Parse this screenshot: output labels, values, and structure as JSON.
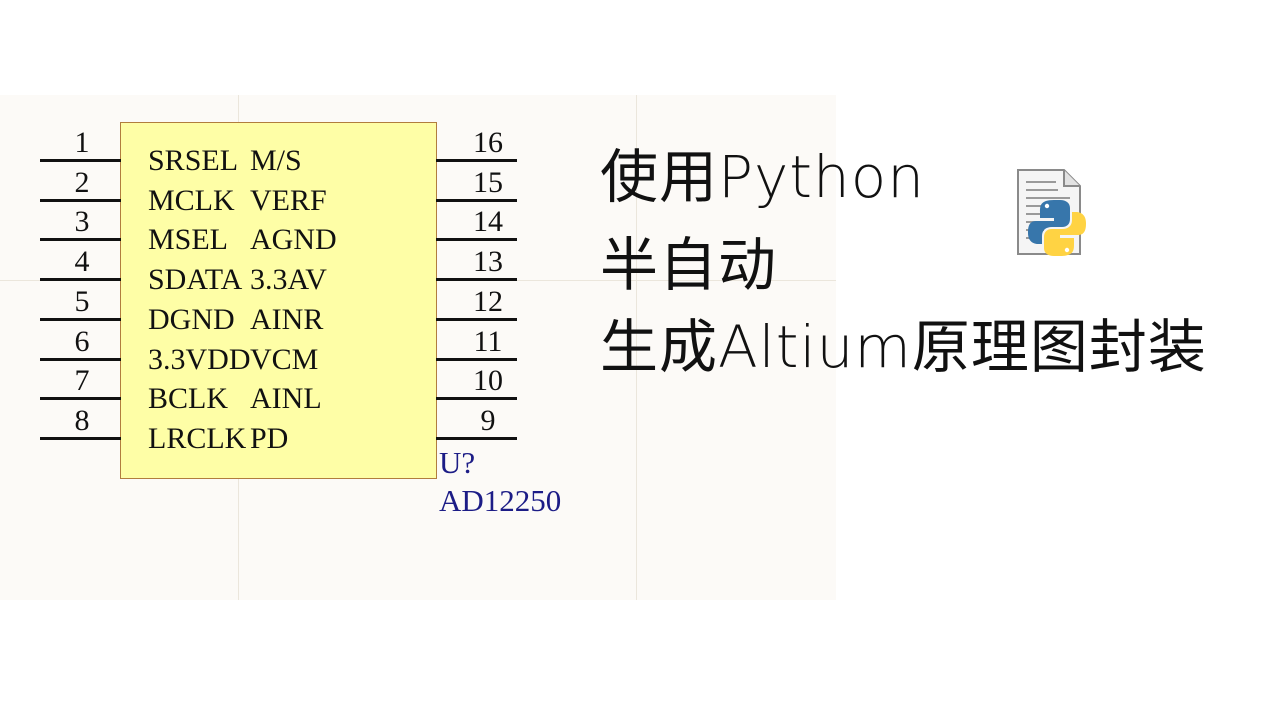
{
  "component": {
    "designator": "U?",
    "part": "AD12250",
    "left_pins": [
      {
        "num": "1",
        "name": "SRSEL"
      },
      {
        "num": "2",
        "name": "MCLK"
      },
      {
        "num": "3",
        "name": "MSEL"
      },
      {
        "num": "4",
        "name": "SDATA"
      },
      {
        "num": "5",
        "name": "DGND"
      },
      {
        "num": "6",
        "name": "3.3VDD"
      },
      {
        "num": "7",
        "name": "BCLK"
      },
      {
        "num": "8",
        "name": "LRCLK"
      }
    ],
    "right_pins": [
      {
        "num": "16",
        "name": "M/S"
      },
      {
        "num": "15",
        "name": "VERF"
      },
      {
        "num": "14",
        "name": "AGND"
      },
      {
        "num": "13",
        "name": "3.3AV"
      },
      {
        "num": "12",
        "name": "AINR"
      },
      {
        "num": "11",
        "name": "VCM"
      },
      {
        "num": "10",
        "name": "AINL"
      },
      {
        "num": "9",
        "name": "PD"
      }
    ]
  },
  "title": {
    "line1": "使用Python",
    "line2": "半自动",
    "line3": "生成Altium原理图封装"
  },
  "icons": {
    "python_file": "python-file-icon"
  },
  "colors": {
    "sheet": "#fcfaf7",
    "chip_fill": "#fefea6",
    "chip_border": "#b17d3e",
    "designator": "#1c1c86"
  }
}
